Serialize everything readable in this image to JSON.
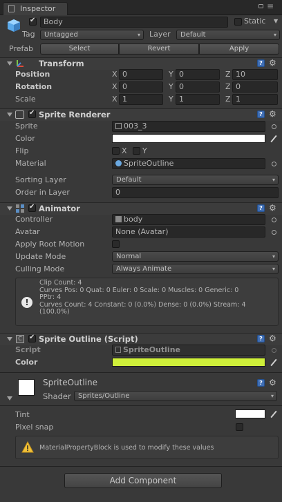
{
  "tab": {
    "title": "Inspector"
  },
  "object": {
    "name": "Body",
    "static_label": "Static",
    "tag_label": "Tag",
    "tag_value": "Untagged",
    "layer_label": "Layer",
    "layer_value": "Default",
    "prefab_label": "Prefab",
    "prefab_buttons": [
      "Select",
      "Revert",
      "Apply"
    ]
  },
  "transform": {
    "title": "Transform",
    "rows": [
      {
        "label": "Position",
        "x": "0",
        "y": "0",
        "z": "10"
      },
      {
        "label": "Rotation",
        "x": "0",
        "y": "0",
        "z": "0"
      },
      {
        "label": "Scale",
        "x": "1",
        "y": "1",
        "z": "1"
      }
    ],
    "axes": [
      "X",
      "Y",
      "Z"
    ]
  },
  "sprite_renderer": {
    "title": "Sprite Renderer",
    "sprite_label": "Sprite",
    "sprite_value": "003_3",
    "color_label": "Color",
    "color_value": "#ffffff",
    "flip_label": "Flip",
    "flip_x": "X",
    "flip_y": "Y",
    "material_label": "Material",
    "material_value": "SpriteOutline",
    "sorting_label": "Sorting Layer",
    "sorting_value": "Default",
    "order_label": "Order in Layer",
    "order_value": "0"
  },
  "animator": {
    "title": "Animator",
    "controller_label": "Controller",
    "controller_value": "body",
    "avatar_label": "Avatar",
    "avatar_value": "None (Avatar)",
    "root_motion_label": "Apply Root Motion",
    "update_label": "Update Mode",
    "update_value": "Normal",
    "culling_label": "Culling Mode",
    "culling_value": "Always Animate",
    "info_lines": [
      "Clip Count: 4",
      "Curves Pos: 0 Quat: 0 Euler: 0 Scale: 0 Muscles: 0 Generic: 0",
      "PPtr: 4",
      "Curves Count: 4 Constant: 0 (0.0%) Dense: 0 (0.0%) Stream: 4",
      "(100.0%)"
    ]
  },
  "sprite_outline": {
    "title": "Sprite Outline (Script)",
    "script_label": "Script",
    "script_value": "SpriteOutline",
    "color_label": "Color",
    "color_value": "#cff03a"
  },
  "material": {
    "name": "SpriteOutline",
    "shader_label": "Shader",
    "shader_value": "Sprites/Outline",
    "tint_label": "Tint",
    "tint_value": "#ffffff",
    "pixel_snap_label": "Pixel snap",
    "warning": "MaterialPropertyBlock is used to modify these values"
  },
  "add_component": "Add Component"
}
